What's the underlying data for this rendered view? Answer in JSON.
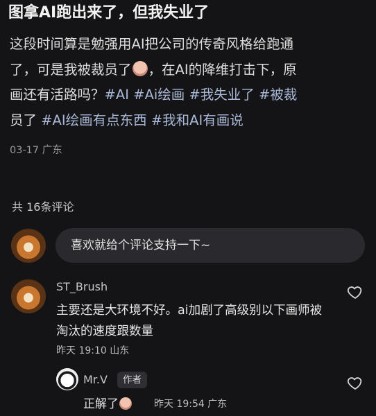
{
  "post": {
    "title": "图拿AI跑出来了，但我失业了",
    "body_line1": "这段时间算是勉强用AI把公司的传奇风格给跑通",
    "body_line2_prefix": "了，可是我被裁员了",
    "body_line2_suffix": "，在AI的降维打击下，原",
    "body_line3_text": "画还有活路吗？",
    "tags_line3": "#AI #Ai绘画 #我失业了 #被裁",
    "line4_text": "员了",
    "tags_line4": "#AI绘画有点东西 #我和AI有画说",
    "meta": "03-17 广东"
  },
  "comments_section": {
    "count_label": "共 16条评论",
    "input_placeholder": "喜欢就给个评论支持一下~"
  },
  "comments": [
    {
      "user": "ST_Brush",
      "text": "主要还是大环境不好。ai加剧了高级别以下画师被淘汰的速度跟数量",
      "meta": "昨天 19:10 山东",
      "reply": {
        "user": "Mr.V",
        "badge": "作者",
        "text": "正解了",
        "meta": "昨天 19:54 广东"
      }
    }
  ],
  "icons": {
    "like": "heart-outline-icon",
    "emoji": "sad-face-emoji-icon"
  }
}
